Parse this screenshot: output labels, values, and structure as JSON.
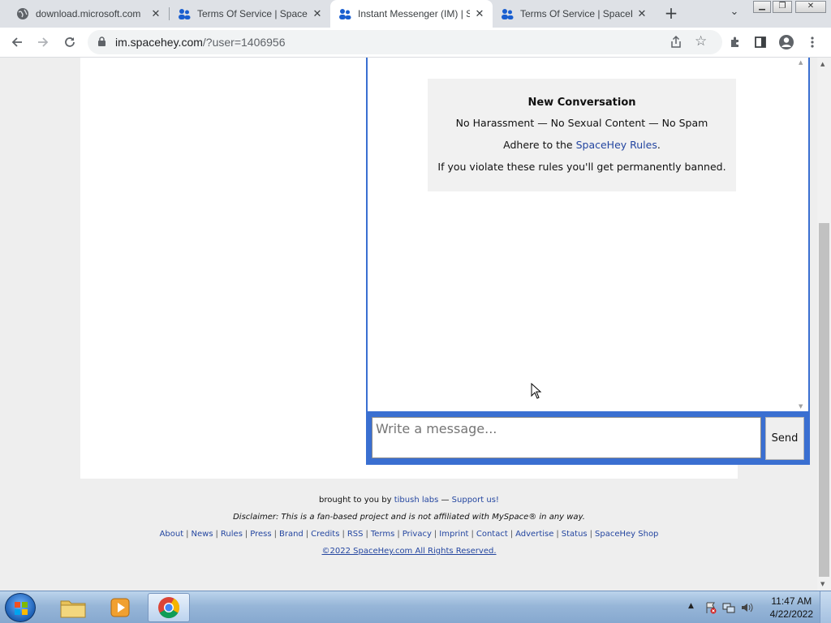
{
  "browser": {
    "tabs": [
      {
        "title": "download.microsoft.com",
        "favicon": "globe-icon",
        "active": false
      },
      {
        "title": "Terms Of Service | SpaceHey",
        "favicon": "spacehey-icon",
        "active": false
      },
      {
        "title": "Instant Messenger (IM) | SpaceHey",
        "favicon": "spacehey-icon",
        "active": true
      },
      {
        "title": "Terms Of Service | SpaceHey",
        "favicon": "spacehey-icon",
        "active": false
      }
    ],
    "url_host": "im.spacehey.com",
    "url_path": "/?user=1406956"
  },
  "im": {
    "notice_title": "New Conversation",
    "notice_rules": "No Harassment — No Sexual Content — No Spam",
    "notice_adhere_prefix": "Adhere to the ",
    "notice_rules_link": "SpaceHey Rules",
    "notice_adhere_suffix": ".",
    "notice_warning": "If you violate these rules you'll get permanently banned.",
    "message_placeholder": "Write a message...",
    "send_label": "Send"
  },
  "footer": {
    "brought_prefix": "brought to you by ",
    "brought_link": "tibush labs",
    "brought_dash": " — ",
    "support_link": "Support us!",
    "disclaimer": "Disclaimer: This is a fan-based project and is not affiliated with MySpace® in any way.",
    "links": [
      "About",
      "News",
      "Rules",
      "Press",
      "Brand",
      "Credits",
      "RSS",
      "Terms",
      "Privacy",
      "Imprint",
      "Contact",
      "Advertise",
      "Status",
      "SpaceHey Shop"
    ],
    "copyright": "©2022 SpaceHey.com All Rights Reserved."
  },
  "taskbar": {
    "time": "11:47 AM",
    "date": "4/22/2022"
  },
  "colors": {
    "accent": "#3a6fd1",
    "link": "#2446a0"
  }
}
